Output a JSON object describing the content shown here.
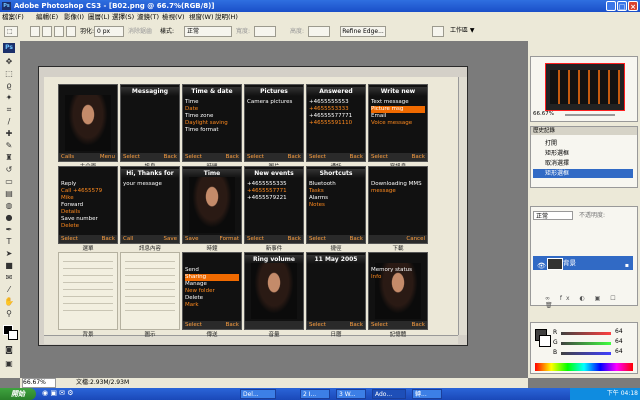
{
  "window": {
    "title": "Adobe Photoshop CS3 - [B02.png @ 66.7%(RGB/8)]",
    "app_icon": "Ps"
  },
  "menu": [
    "檔案(F)",
    "編輯(E)",
    "影像(I)",
    "圖層(L)",
    "選擇(S)",
    "濾鏡(T)",
    "檢視(V)",
    "視窗(W)",
    "說明(H)"
  ],
  "options": {
    "feather_label": "羽化:",
    "feather_value": "0 px",
    "antialias_label": "消除鋸齒",
    "style_label": "樣式:",
    "style_value": "正常",
    "width_label": "寬度:",
    "height_label": "高度:",
    "refine_button": "Refine Edge...",
    "workspace_button": "工作區 ▼"
  },
  "status": {
    "zoom": "66.67%",
    "doc_info": "文檔:2.93M/2.93M"
  },
  "screens": [
    {
      "id": "s1",
      "header": "",
      "lines": [],
      "left": "Calls",
      "right": "Menu",
      "caption": "主介面"
    },
    {
      "id": "s2",
      "header": "Messaging",
      "lines": [],
      "left": "Select",
      "right": "Back",
      "caption": "訊息"
    },
    {
      "id": "s3",
      "header": "Time & date",
      "lines": [
        "Time",
        "Date",
        "Time zone",
        "Daylight saving",
        "Time format"
      ],
      "left": "Select",
      "right": "Back",
      "caption": "時間"
    },
    {
      "id": "s4",
      "header": "Pictures",
      "lines": [
        "Camera pictures"
      ],
      "left": "Select",
      "right": "Back",
      "caption": "圖片"
    },
    {
      "id": "s5",
      "header": "Answered",
      "lines": [
        "+4655555553",
        "+4655553333",
        "+46555577771",
        "+46555591110"
      ],
      "left": "Select",
      "right": "Back",
      "caption": "通話"
    },
    {
      "id": "s6",
      "header": "Write new",
      "lines": [
        "Text message",
        "Picture msg",
        "Email",
        "Voice message"
      ],
      "left": "Select",
      "right": "Back",
      "caption": "寫訊息"
    },
    {
      "id": "s7",
      "header": "",
      "lines": [
        "Reply",
        "Call +4655579 Mike",
        "Forward",
        "Details",
        "Save number",
        "Delete"
      ],
      "left": "Select",
      "right": "Back",
      "caption": "選單"
    },
    {
      "id": "s8",
      "header": "Hi, Thanks for",
      "lines": [
        "your message"
      ],
      "left": "Call",
      "right": "Save",
      "caption": "訊息內容"
    },
    {
      "id": "s9",
      "header": "Time",
      "lines": [],
      "left": "Save",
      "right": "Format",
      "caption": "時鐘"
    },
    {
      "id": "s10",
      "header": "New events",
      "lines": [
        "+4655555335",
        "+4655557771",
        "+4655579221"
      ],
      "left": "Select",
      "right": "Back",
      "caption": "新事件"
    },
    {
      "id": "s11",
      "header": "Shortcuts",
      "lines": [
        "Bluetooth",
        "Tasks",
        "Alarms",
        "Notes"
      ],
      "left": "Select",
      "right": "Back",
      "caption": "捷徑"
    },
    {
      "id": "s12",
      "header": "",
      "lines": [
        "Downloading MMS",
        "message"
      ],
      "left": "",
      "right": "Cancel",
      "caption": "下載"
    },
    {
      "id": "s13",
      "header": "",
      "lines": [],
      "left": "",
      "right": "",
      "caption": "背景"
    },
    {
      "id": "s14",
      "header": "",
      "lines": [],
      "left": "",
      "right": "",
      "caption": "圖示"
    },
    {
      "id": "s15",
      "header": "",
      "lines": [
        "Send",
        "Sharing",
        "Manage",
        "New folder",
        "Delete",
        "Mark"
      ],
      "left": "Select",
      "right": "Back",
      "caption": "傳送"
    },
    {
      "id": "s16",
      "header": "Ring volume",
      "lines": [],
      "left": "",
      "right": "",
      "caption": "音量"
    },
    {
      "id": "s17",
      "header": "11 May 2005",
      "lines": [],
      "left": "Select",
      "right": "Back",
      "caption": "日曆"
    },
    {
      "id": "s18",
      "header": "",
      "lines": [
        "Memory status",
        "Info"
      ],
      "left": "Select",
      "right": "Back",
      "caption": "記憶體"
    }
  ],
  "screen_highlights": {
    "s15": "Sharing",
    "s6": "Picture msg"
  },
  "history": {
    "tab": "歷史記錄",
    "items": [
      "打開",
      "矩形選框",
      "取消選擇",
      "矩形選框"
    ],
    "selected_index": 3
  },
  "layers": {
    "mode": "正常",
    "opacity_label": "不透明度:",
    "layer_name": "背景"
  },
  "color": {
    "r": "64",
    "g": "64",
    "b": "64"
  },
  "navigator": {
    "zoom": "66.67%"
  },
  "taskbar": {
    "start": "開始",
    "tasks": [
      "Del...",
      "2 I...",
      "3 W...",
      "Ado...",
      "轉..."
    ],
    "time": "下午 04:18"
  },
  "colors": {
    "accent": "#f06a00",
    "title": "#1a4fc8",
    "selection": "#316ac5"
  }
}
